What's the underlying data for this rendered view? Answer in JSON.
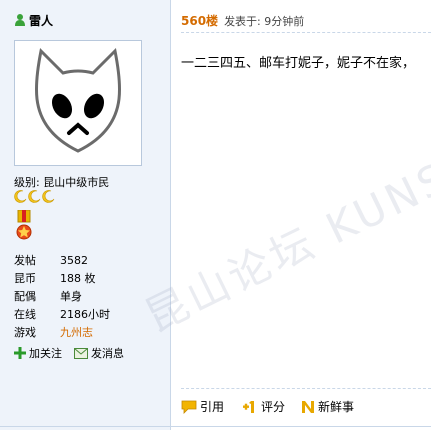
{
  "user": {
    "name": "雷人",
    "level_label": "级别: 昆山中级市民",
    "stats": [
      {
        "label": "发帖",
        "value": "3582"
      },
      {
        "label": "昆币",
        "value": "188 枚"
      },
      {
        "label": "配偶",
        "value": "单身"
      },
      {
        "label": "在线",
        "value": "2186小时"
      },
      {
        "label": "游戏",
        "value": "九州志"
      }
    ],
    "actions": {
      "follow": "加关注",
      "message": "发消息"
    }
  },
  "post": {
    "floor": "560楼",
    "posted_time": "发表于: 9分钟前",
    "content": "一二三四五、邮车打妮子，妮子不在家，",
    "actions": {
      "quote": "引用",
      "rate": "评分",
      "fresh": "新鲜事"
    }
  },
  "watermark": "昆山论坛 KUNSHANBBS",
  "colors": {
    "accent": "#d46b00",
    "sidebar_bg": "#eef3fa",
    "border": "#c9d7e8"
  }
}
